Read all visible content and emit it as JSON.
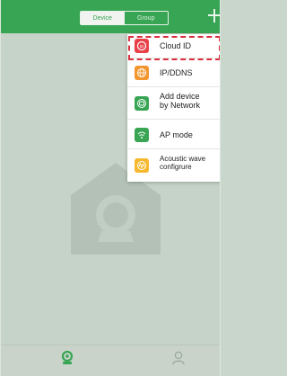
{
  "header": {
    "segment": {
      "device_label": "Device",
      "group_label": "Group",
      "selected": "Device"
    },
    "add_icon": "plus-icon"
  },
  "content": {
    "placeholder_icon": "home-camera-icon"
  },
  "menu": {
    "items": [
      {
        "label": "Cloud ID",
        "icon": "cloud-id-icon",
        "color": "#e8414a"
      },
      {
        "label": "IP/DDNS",
        "icon": "globe-icon",
        "color": "#f2962e"
      },
      {
        "label": "Add device\nby Network",
        "icon": "network-icon",
        "color": "#37a553"
      },
      {
        "label": "AP mode",
        "icon": "wifi-icon",
        "color": "#37a553"
      },
      {
        "label": "Acoustic wave\nconfigrure",
        "icon": "sound-wave-icon",
        "color": "#f5b82e"
      }
    ],
    "highlight_color": "#d9313c"
  },
  "tabbar": {
    "tabs": [
      {
        "label": "",
        "icon": "device-tab-icon",
        "active": true
      },
      {
        "label": "",
        "icon": "user-tab-icon",
        "active": false
      }
    ]
  },
  "colors": {
    "brand_green": "#37a553",
    "overlay": "#c6d3c8"
  }
}
